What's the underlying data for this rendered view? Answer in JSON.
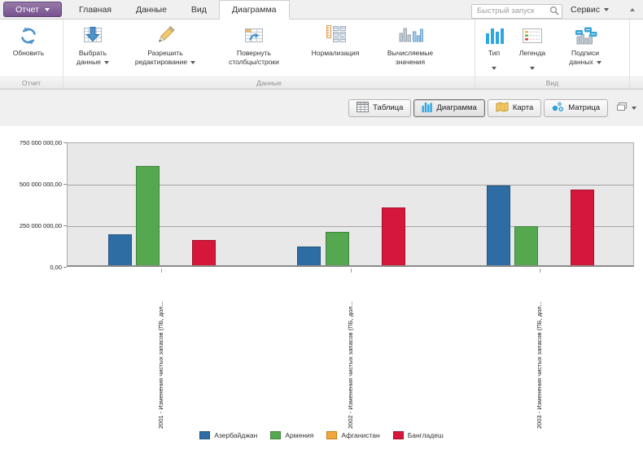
{
  "tab_bar": {
    "report_button": {
      "label": "Отчет"
    },
    "tabs": [
      {
        "name": "home",
        "label": "Главная",
        "active": false
      },
      {
        "name": "data",
        "label": "Данные",
        "active": false
      },
      {
        "name": "view",
        "label": "Вид",
        "active": false
      },
      {
        "name": "chart",
        "label": "Диаграмма",
        "active": true
      }
    ],
    "search": {
      "placeholder": "Быстрый запуск"
    },
    "service_menu": {
      "label": "Сервис"
    }
  },
  "ribbon": {
    "groups": [
      {
        "name": "report",
        "label": "Отчет",
        "buttons": [
          {
            "name": "refresh",
            "icon": "refresh-icon",
            "lines": [
              "Обновить"
            ],
            "arrow": null
          }
        ]
      },
      {
        "name": "data",
        "label": "Данные",
        "buttons": [
          {
            "name": "select-data",
            "icon": "select-data-icon",
            "lines": [
              "Выбрать",
              "данные"
            ],
            "arrow": "inline"
          },
          {
            "name": "allow-edit",
            "icon": "pencil-icon",
            "lines": [
              "Разрешить",
              "редактирование"
            ],
            "arrow": "inline"
          },
          {
            "name": "rotate-columns",
            "icon": "rotate-columns-icon",
            "lines": [
              "Повернуть",
              "столбцы/строки"
            ],
            "arrow": null
          },
          {
            "name": "normalization",
            "icon": "normalization-icon",
            "lines": [
              "Нормализация"
            ],
            "arrow": null
          },
          {
            "name": "computed-values",
            "icon": "computed-values-icon",
            "lines": [
              "Вычисляемые",
              "значения"
            ],
            "arrow": null
          }
        ]
      },
      {
        "name": "view",
        "label": "Вид",
        "buttons": [
          {
            "name": "chart-type",
            "icon": "chart-type-icon",
            "lines": [
              "Тип"
            ],
            "arrow": "below"
          },
          {
            "name": "legend",
            "icon": "legend-icon",
            "lines": [
              "Легенда"
            ],
            "arrow": "below"
          },
          {
            "name": "data-labels",
            "icon": "data-labels-icon",
            "lines": [
              "Подписи",
              "данных"
            ],
            "arrow": "inline"
          }
        ]
      }
    ]
  },
  "view_switcher": {
    "buttons": [
      {
        "name": "table",
        "label": "Таблица",
        "icon": "table-icon",
        "active": false
      },
      {
        "name": "chart",
        "label": "Диаграмма",
        "icon": "chart-sw-icon",
        "active": true
      },
      {
        "name": "map",
        "label": "Карта",
        "icon": "map-icon",
        "active": false
      },
      {
        "name": "matrix",
        "label": "Матрица",
        "icon": "matrix-icon",
        "active": false
      }
    ]
  },
  "chart_data": {
    "type": "bar",
    "title": "",
    "xlabel": "",
    "ylabel": "",
    "grid": true,
    "legend_position": "bottom",
    "plot_background": "#e8e8e9",
    "ylim": [
      0,
      750000000
    ],
    "yticks": [
      {
        "value": 0,
        "label": "0,00"
      },
      {
        "value": 250000000,
        "label": "250 000 000,00"
      },
      {
        "value": 500000000,
        "label": "500 000 000,00"
      },
      {
        "value": 750000000,
        "label": "750 000 000,00"
      }
    ],
    "categories": [
      "2001 - Изменения чистых запасов (ПБ, дол...",
      "2002 - Изменения чистых запасов (ПБ, дол...",
      "2003 - Изменения чистых запасов (ПБ, дол..."
    ],
    "series": [
      {
        "name": "Азербайджан",
        "color": "#2e6da4",
        "border": "#24557f",
        "values": [
          185000000,
          113000000,
          480000000
        ]
      },
      {
        "name": "Армения",
        "color": "#55a84f",
        "border": "#3f863a",
        "values": [
          600000000,
          200000000,
          235000000
        ]
      },
      {
        "name": "Афганистан",
        "color": "#f0a63e",
        "border": "#c47f1d",
        "values": [
          0,
          0,
          0
        ]
      },
      {
        "name": "Бангладеш",
        "color": "#d6173c",
        "border": "#a60e2c",
        "values": [
          150000000,
          350000000,
          455000000
        ]
      }
    ]
  }
}
